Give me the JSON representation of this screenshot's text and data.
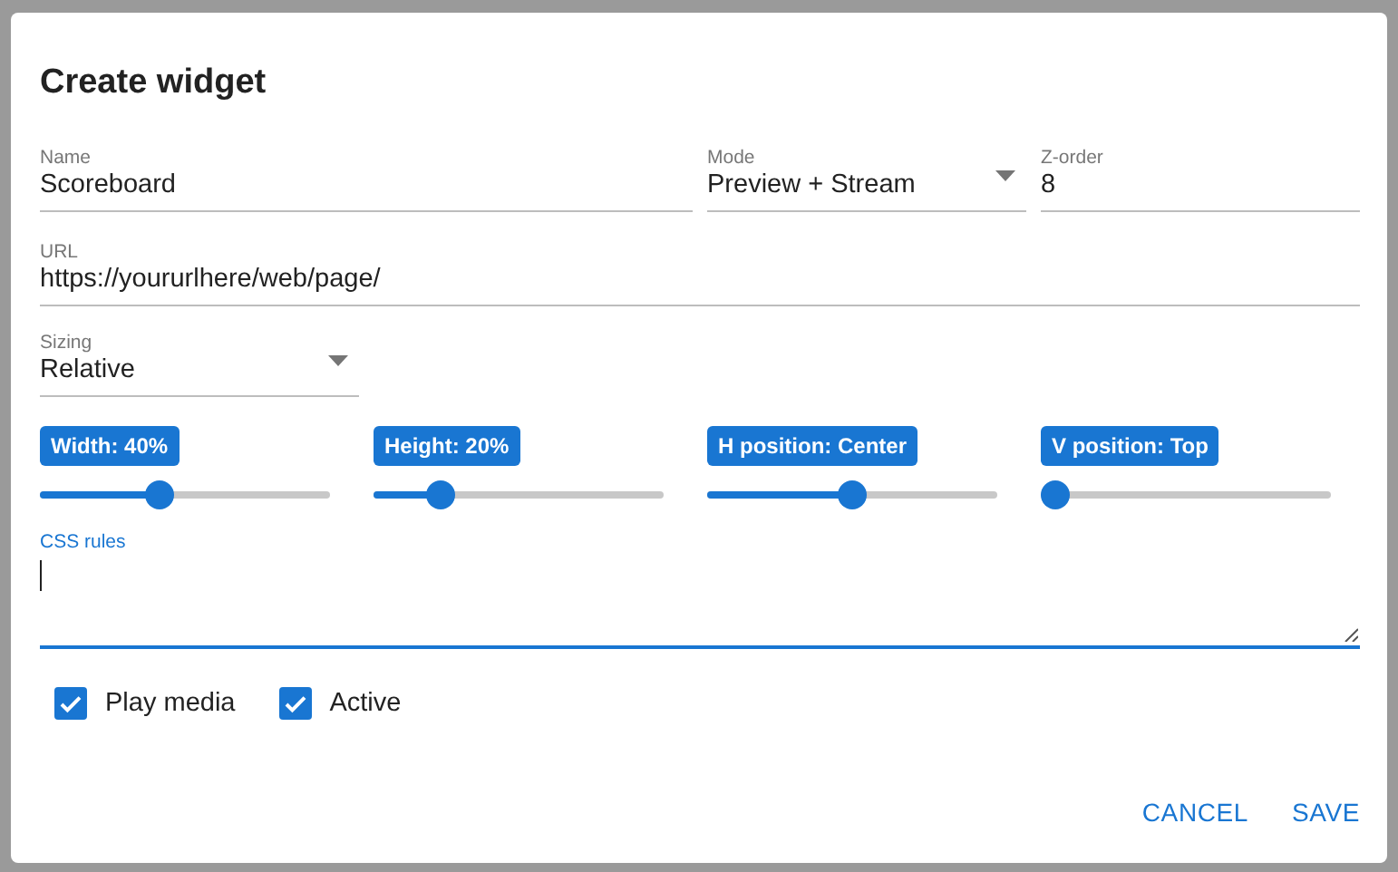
{
  "dialog": {
    "title": "Create widget",
    "fields": [
      {
        "kind": "text",
        "label": "Name",
        "value": "Scoreboard"
      },
      {
        "kind": "select",
        "label": "Mode",
        "value": "Preview + Stream"
      },
      {
        "kind": "text",
        "label": "Z-order",
        "value": "8"
      }
    ],
    "url": {
      "label": "URL",
      "value": "https://yoururlhere/web/page/"
    },
    "sizing": {
      "kind": "select",
      "label": "Sizing",
      "value": "Relative"
    },
    "sliders": [
      {
        "label": "Width: 40%",
        "level": 0.4
      },
      {
        "label": "Height: 20%",
        "level": 0.2
      },
      {
        "label": "H position: Center",
        "level": 0.5
      },
      {
        "label": "V position: Top",
        "level": 0
      }
    ],
    "css_rules": {
      "label": "CSS rules",
      "focused": true
    },
    "checkboxes": [
      {
        "label": "Play media",
        "checked": true
      },
      {
        "label": "Active",
        "checked": true
      }
    ],
    "buttons": [
      "CANCEL",
      "SAVE"
    ]
  }
}
